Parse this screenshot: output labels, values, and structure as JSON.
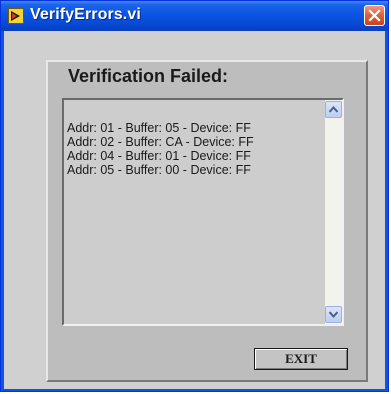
{
  "window": {
    "title": "VerifyErrors.vi",
    "icon": "labview-vi-icon"
  },
  "panel": {
    "heading": "Verification Failed:",
    "lines": [
      "Addr: 01 - Buffer: 05 - Device: FF",
      "Addr: 02 - Buffer: CA - Device: FF",
      "Addr: 04 - Buffer: 01 - Device: FF",
      "Addr: 05 - Buffer: 00 - Device: FF"
    ],
    "exit_label": "EXIT"
  },
  "colors": {
    "titlebar": "#0a55e3",
    "close_button": "#e0623c",
    "client_background": "#d0d0d0",
    "panel_background": "#bdbdbd",
    "textbox_background": "#cdcdcd"
  }
}
